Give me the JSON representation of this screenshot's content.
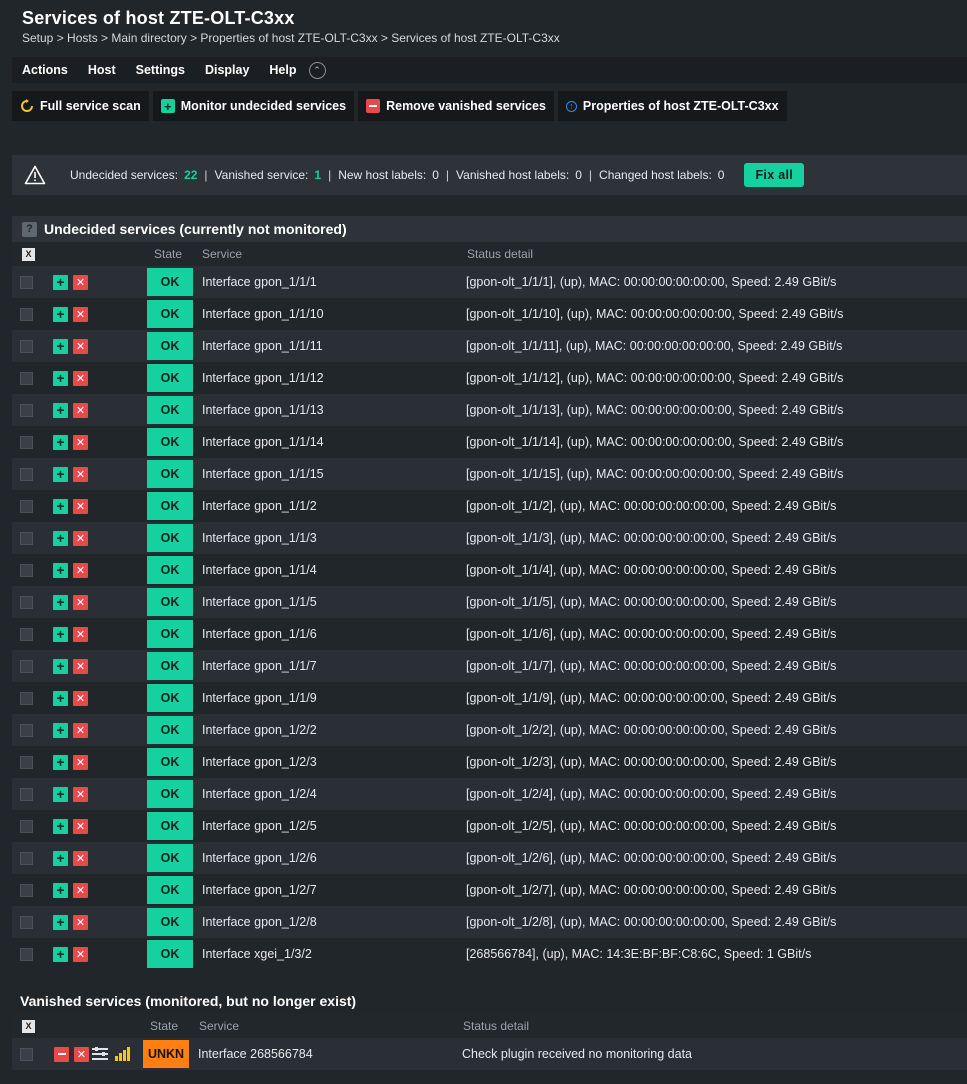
{
  "header": {
    "title": "Services of host ZTE-OLT-C3xx",
    "breadcrumb": "Setup > Hosts > Main directory > Properties of host ZTE-OLT-C3xx > Services of host ZTE-OLT-C3xx"
  },
  "menu": [
    "Actions",
    "Host",
    "Settings",
    "Display",
    "Help"
  ],
  "toolbar": {
    "full_scan": "Full service scan",
    "monitor_undecided": "Monitor undecided services",
    "remove_vanished": "Remove vanished services",
    "properties": "Properties of host ZTE-OLT-C3xx"
  },
  "status": {
    "undecided_label": "Undecided services:",
    "undecided_value": "22",
    "vanished_label": "Vanished service:",
    "vanished_value": "1",
    "new_labels_label": "New host labels:",
    "new_labels_value": "0",
    "vanished_labels_label": "Vanished host labels:",
    "vanished_labels_value": "0",
    "changed_labels_label": "Changed host labels:",
    "changed_labels_value": "0",
    "fix_all": "Fix all"
  },
  "undecided": {
    "title": "Undecided services (currently not monitored)",
    "columns": {
      "x": "X",
      "state": "State",
      "service": "Service",
      "detail": "Status detail"
    },
    "rows": [
      {
        "state": "OK",
        "service": "Interface gpon_1/1/1",
        "detail": "[gpon-olt_1/1/1], (up), MAC: 00:00:00:00:00:00, Speed: 2.49 GBit/s"
      },
      {
        "state": "OK",
        "service": "Interface gpon_1/1/10",
        "detail": "[gpon-olt_1/1/10], (up), MAC: 00:00:00:00:00:00, Speed: 2.49 GBit/s"
      },
      {
        "state": "OK",
        "service": "Interface gpon_1/1/11",
        "detail": "[gpon-olt_1/1/11], (up), MAC: 00:00:00:00:00:00, Speed: 2.49 GBit/s"
      },
      {
        "state": "OK",
        "service": "Interface gpon_1/1/12",
        "detail": "[gpon-olt_1/1/12], (up), MAC: 00:00:00:00:00:00, Speed: 2.49 GBit/s"
      },
      {
        "state": "OK",
        "service": "Interface gpon_1/1/13",
        "detail": "[gpon-olt_1/1/13], (up), MAC: 00:00:00:00:00:00, Speed: 2.49 GBit/s"
      },
      {
        "state": "OK",
        "service": "Interface gpon_1/1/14",
        "detail": "[gpon-olt_1/1/14], (up), MAC: 00:00:00:00:00:00, Speed: 2.49 GBit/s"
      },
      {
        "state": "OK",
        "service": "Interface gpon_1/1/15",
        "detail": "[gpon-olt_1/1/15], (up), MAC: 00:00:00:00:00:00, Speed: 2.49 GBit/s"
      },
      {
        "state": "OK",
        "service": "Interface gpon_1/1/2",
        "detail": "[gpon-olt_1/1/2], (up), MAC: 00:00:00:00:00:00, Speed: 2.49 GBit/s"
      },
      {
        "state": "OK",
        "service": "Interface gpon_1/1/3",
        "detail": "[gpon-olt_1/1/3], (up), MAC: 00:00:00:00:00:00, Speed: 2.49 GBit/s"
      },
      {
        "state": "OK",
        "service": "Interface gpon_1/1/4",
        "detail": "[gpon-olt_1/1/4], (up), MAC: 00:00:00:00:00:00, Speed: 2.49 GBit/s"
      },
      {
        "state": "OK",
        "service": "Interface gpon_1/1/5",
        "detail": "[gpon-olt_1/1/5], (up), MAC: 00:00:00:00:00:00, Speed: 2.49 GBit/s"
      },
      {
        "state": "OK",
        "service": "Interface gpon_1/1/6",
        "detail": "[gpon-olt_1/1/6], (up), MAC: 00:00:00:00:00:00, Speed: 2.49 GBit/s"
      },
      {
        "state": "OK",
        "service": "Interface gpon_1/1/7",
        "detail": "[gpon-olt_1/1/7], (up), MAC: 00:00:00:00:00:00, Speed: 2.49 GBit/s"
      },
      {
        "state": "OK",
        "service": "Interface gpon_1/1/9",
        "detail": "[gpon-olt_1/1/9], (up), MAC: 00:00:00:00:00:00, Speed: 2.49 GBit/s"
      },
      {
        "state": "OK",
        "service": "Interface gpon_1/2/2",
        "detail": "[gpon-olt_1/2/2], (up), MAC: 00:00:00:00:00:00, Speed: 2.49 GBit/s"
      },
      {
        "state": "OK",
        "service": "Interface gpon_1/2/3",
        "detail": "[gpon-olt_1/2/3], (up), MAC: 00:00:00:00:00:00, Speed: 2.49 GBit/s"
      },
      {
        "state": "OK",
        "service": "Interface gpon_1/2/4",
        "detail": "[gpon-olt_1/2/4], (up), MAC: 00:00:00:00:00:00, Speed: 2.49 GBit/s"
      },
      {
        "state": "OK",
        "service": "Interface gpon_1/2/5",
        "detail": "[gpon-olt_1/2/5], (up), MAC: 00:00:00:00:00:00, Speed: 2.49 GBit/s"
      },
      {
        "state": "OK",
        "service": "Interface gpon_1/2/6",
        "detail": "[gpon-olt_1/2/6], (up), MAC: 00:00:00:00:00:00, Speed: 2.49 GBit/s"
      },
      {
        "state": "OK",
        "service": "Interface gpon_1/2/7",
        "detail": "[gpon-olt_1/2/7], (up), MAC: 00:00:00:00:00:00, Speed: 2.49 GBit/s"
      },
      {
        "state": "OK",
        "service": "Interface gpon_1/2/8",
        "detail": "[gpon-olt_1/2/8], (up), MAC: 00:00:00:00:00:00, Speed: 2.49 GBit/s"
      },
      {
        "state": "OK",
        "service": "Interface xgei_1/3/2",
        "detail": "[268566784], (up), MAC: 14:3E:BF:BF:C8:6C, Speed: 1 GBit/s"
      }
    ]
  },
  "vanished": {
    "title": "Vanished services (monitored, but no longer exist)",
    "columns": {
      "x": "X",
      "state": "State",
      "service": "Service",
      "detail": "Status detail"
    },
    "rows": [
      {
        "state": "UNKN",
        "service": "Interface 268566784",
        "detail": "Check plugin received no monitoring data"
      }
    ]
  },
  "colors": {
    "ok": "#15d1a0",
    "unkn": "#ff7f11",
    "remove": "#e64a4a",
    "background": "#21262b"
  },
  "icons": {
    "full_scan": "refresh-icon",
    "monitor": "plus-icon",
    "remove": "minus-icon",
    "properties": "info-icon",
    "warning": "warning-triangle-icon",
    "help": "question-icon"
  }
}
